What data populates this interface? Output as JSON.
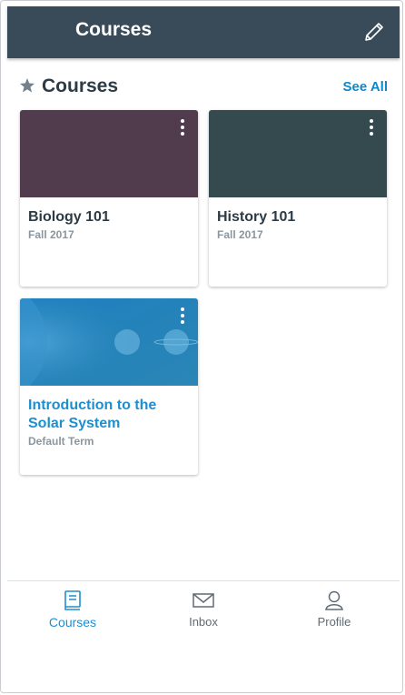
{
  "header": {
    "title": "Courses"
  },
  "section": {
    "title": "Courses",
    "see_all": "See All"
  },
  "courses": [
    {
      "name": "Biology 101",
      "term": "Fall 2017",
      "color": "#503c4c"
    },
    {
      "name": "History 101",
      "term": "Fall 2017",
      "color": "#344a4f"
    },
    {
      "name": "Introduction to the Solar System",
      "term": "Default Term",
      "color": "#2b82b8"
    }
  ],
  "tabs": [
    {
      "label": "Courses",
      "icon": "book-icon",
      "active": true
    },
    {
      "label": "Inbox",
      "icon": "envelope-icon",
      "active": false
    },
    {
      "label": "Profile",
      "icon": "user-icon",
      "active": false
    }
  ],
  "colors": {
    "header_bg": "#394b58",
    "accent": "#0f87c8"
  }
}
